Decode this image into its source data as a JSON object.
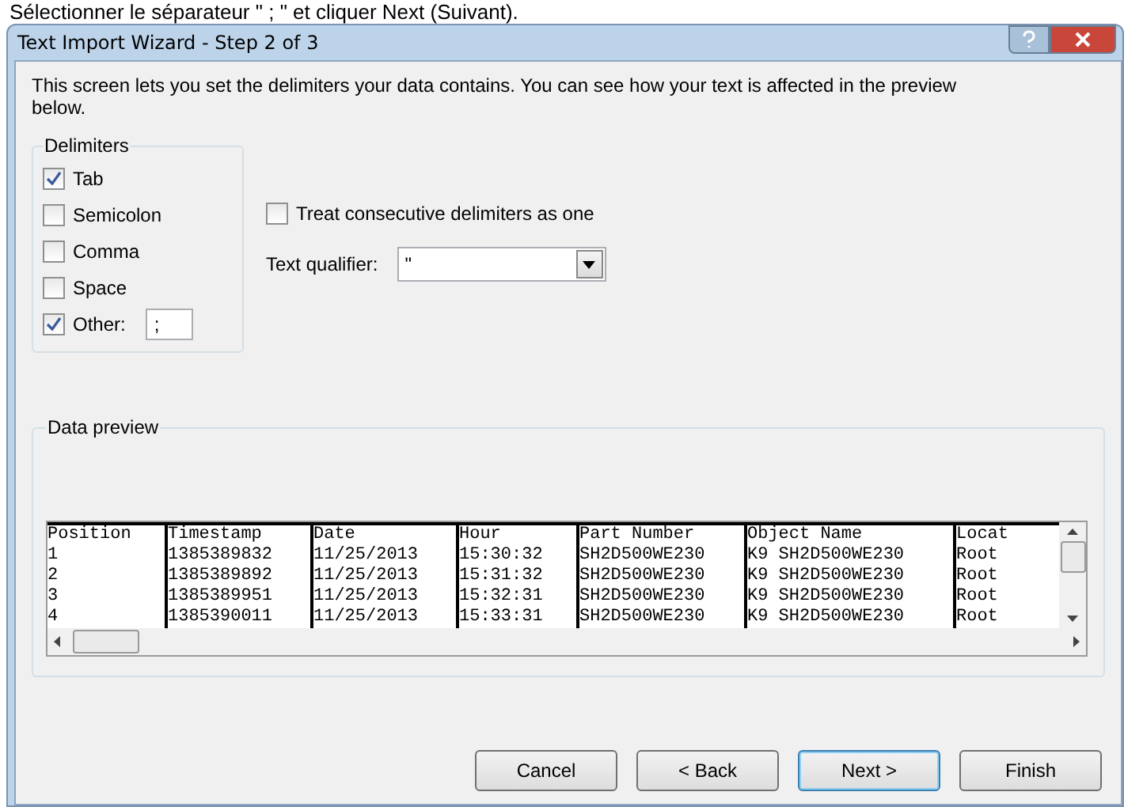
{
  "caption": "Sélectionner le séparateur \" ; \" et cliquer Next (Suivant).",
  "window": {
    "title": "Text Import Wizard - Step 2 of 3"
  },
  "description": "This screen lets you set the delimiters your data contains.  You can see how your text is affected in the preview below.",
  "delimiters": {
    "title": "Delimiters",
    "items": [
      {
        "label": "Tab",
        "checked": true
      },
      {
        "label": "Semicolon",
        "checked": false
      },
      {
        "label": "Comma",
        "checked": false
      },
      {
        "label": "Space",
        "checked": false
      },
      {
        "label": "Other:",
        "checked": true,
        "value": ";"
      }
    ]
  },
  "consecutive": {
    "label": "Treat consecutive delimiters as one",
    "checked": false
  },
  "qualifier": {
    "label": "Text qualifier:",
    "value": "\""
  },
  "preview": {
    "title": "Data preview",
    "columns": [
      "Position",
      "Timestamp",
      "Date",
      "Hour",
      "Part Number",
      "Object Name",
      "Locat"
    ],
    "rows": [
      [
        "1",
        "1385389832",
        "11/25/2013",
        "15:30:32",
        "SH2D500WE230",
        "K9 SH2D500WE230",
        "Root"
      ],
      [
        "2",
        "1385389892",
        "11/25/2013",
        "15:31:32",
        "SH2D500WE230",
        "K9 SH2D500WE230",
        "Root"
      ],
      [
        "3",
        "1385389951",
        "11/25/2013",
        "15:32:31",
        "SH2D500WE230",
        "K9 SH2D500WE230",
        "Root"
      ],
      [
        "4",
        "1385390011",
        "11/25/2013",
        "15:33:31",
        "SH2D500WE230",
        "K9 SH2D500WE230",
        "Root"
      ]
    ]
  },
  "buttons": [
    {
      "label": "Cancel",
      "selected": false
    },
    {
      "label": "< Back",
      "selected": false
    },
    {
      "label": "Next >",
      "selected": true
    },
    {
      "label": "Finish",
      "selected": false
    }
  ]
}
